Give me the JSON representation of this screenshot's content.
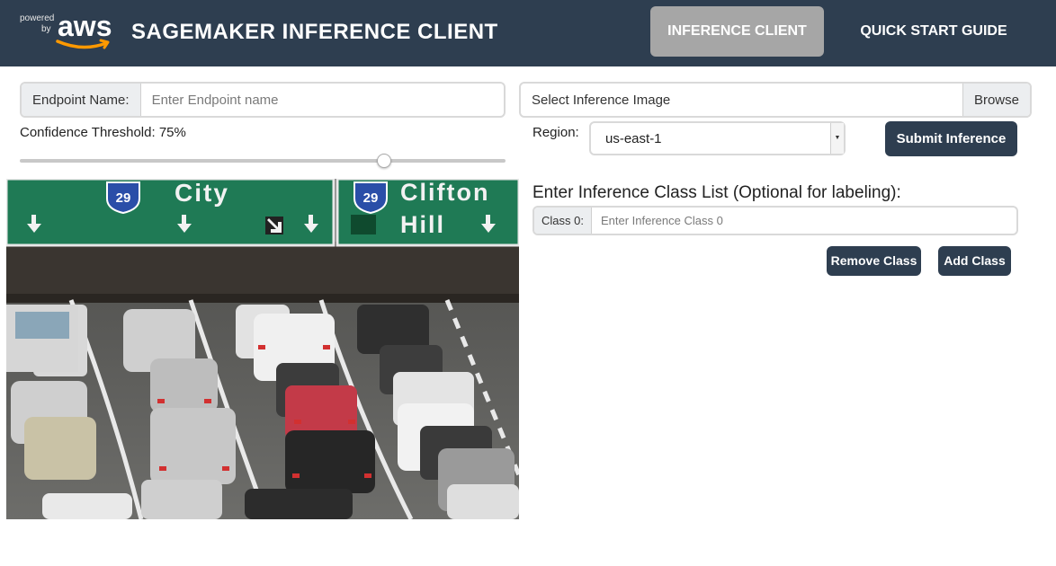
{
  "header": {
    "logo_powered": "powered",
    "logo_by": "by",
    "logo_brand": "aws",
    "title": "SAGEMAKER INFERENCE CLIENT",
    "nav": [
      {
        "label": "INFERENCE CLIENT",
        "active": true
      },
      {
        "label": "QUICK START GUIDE",
        "active": false
      }
    ]
  },
  "endpoint": {
    "label": "Endpoint Name:",
    "placeholder": "Enter Endpoint name",
    "value": ""
  },
  "image_picker": {
    "text": "Select Inference Image",
    "browse_label": "Browse"
  },
  "confidence": {
    "label": "Confidence Threshold: 75%",
    "value_percent": 75
  },
  "region": {
    "label": "Region:",
    "selected": "us-east-1"
  },
  "submit_label": "Submit Inference",
  "classes": {
    "heading": "Enter Inference Class List (Optional for labeling):",
    "rows": [
      {
        "label": "Class 0:",
        "placeholder": "Enter Inference Class 0"
      }
    ],
    "remove_label": "Remove Class",
    "add_label": "Add Class"
  },
  "photo": {
    "signs": [
      {
        "route": "29",
        "text": "City"
      },
      {
        "route": "29",
        "text_line1": "Clifton",
        "text_line2": "Hill"
      }
    ]
  },
  "colors": {
    "header_bg": "#2e3e50",
    "nav_active_bg": "#a6a6a6",
    "button_bg": "#2e3e50",
    "sign_green": "#1f7a55"
  }
}
